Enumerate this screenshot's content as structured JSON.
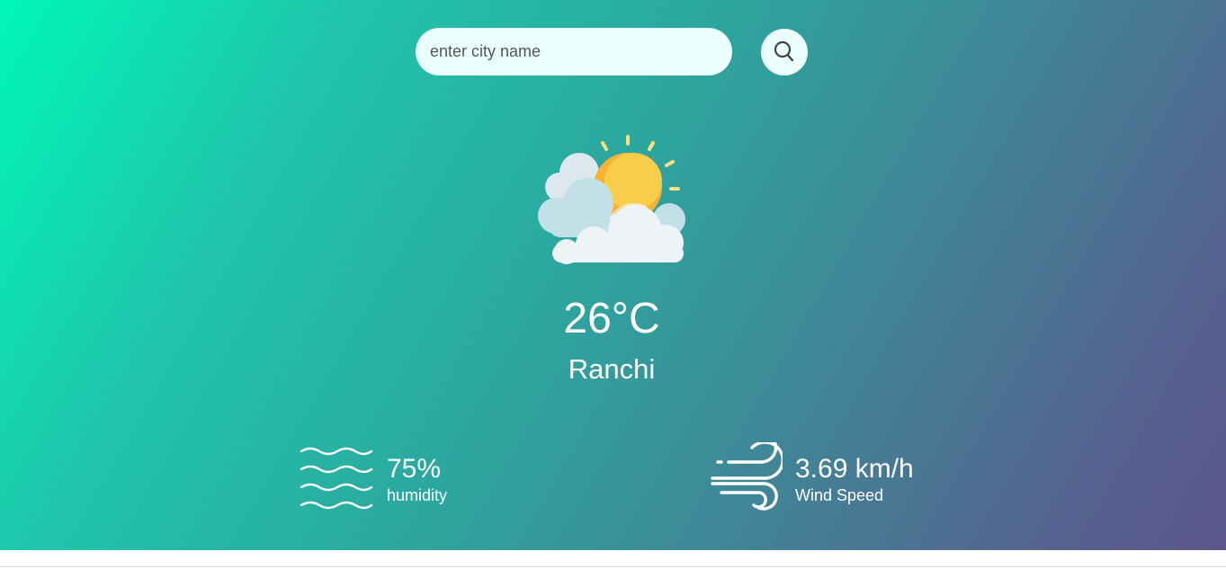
{
  "search": {
    "placeholder": "enter city name",
    "value": "",
    "button_icon": "search-icon"
  },
  "weather": {
    "icon": "partly-cloudy-sun-icon",
    "temperature": "26°C",
    "city": "Ranchi"
  },
  "details": {
    "humidity": {
      "icon": "humidity-waves-icon",
      "value": "75%",
      "label": "humidity"
    },
    "wind": {
      "icon": "wind-icon",
      "value": "3.69 km/h",
      "label": "Wind Speed"
    }
  },
  "colors": {
    "gradient_start": "#00f7b6",
    "gradient_end": "#5d568a",
    "input_background": "#ebfffc",
    "text": "#ffffff",
    "sun": "#f9b233",
    "cloud": "#eef3f6"
  }
}
